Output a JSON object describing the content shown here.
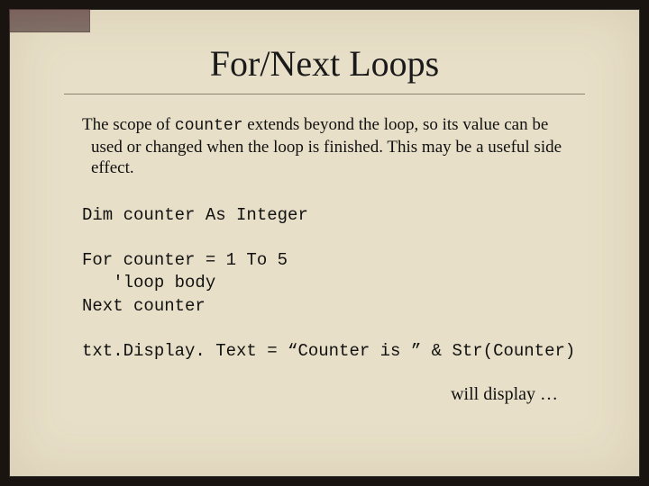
{
  "title": "For/Next Loops",
  "paragraph_pre": "The scope of ",
  "paragraph_code": "counter",
  "paragraph_post": " extends beyond the loop, so its value can be used or changed when the loop is finished. This may be a useful side effect.",
  "code_block_1": "Dim counter As Integer",
  "code_block_2": "For counter = 1 To 5\n   'loop body\nNext counter",
  "code_block_3": "txt.Display. Text = “Counter is ” & Str(Counter)",
  "footer": "will display …"
}
